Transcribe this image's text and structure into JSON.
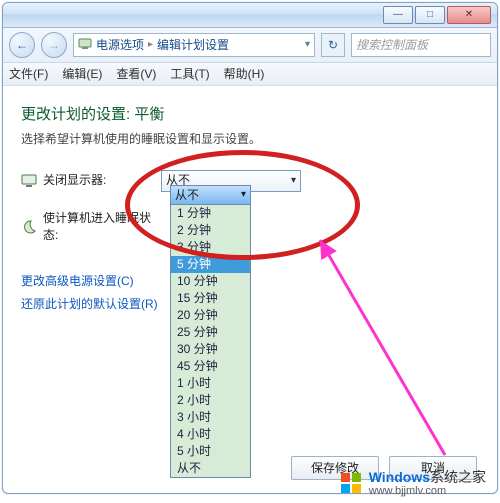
{
  "window": {
    "min": "—",
    "max": "□",
    "close": "✕"
  },
  "nav": {
    "back": "←",
    "forward": "→",
    "refresh": "↻",
    "crumb1": "电源选项",
    "crumb2": "编辑计划设置",
    "sep": "▸",
    "drop": "▾",
    "search_placeholder": "搜索控制面板"
  },
  "menu": {
    "file": "文件(F)",
    "edit": "编辑(E)",
    "view": "查看(V)",
    "tools": "工具(T)",
    "help": "帮助(H)"
  },
  "page": {
    "title": "更改计划的设置: 平衡",
    "subtitle": "选择希望计算机使用的睡眠设置和显示设置。"
  },
  "rows": {
    "display_off": "关闭显示器:",
    "sleep": "使计算机进入睡眠状态:",
    "display_value": "从不",
    "display_arrow": "▾"
  },
  "links": {
    "advanced": "更改高级电源设置(C)",
    "restore": "还原此计划的默认设置(R)"
  },
  "buttons": {
    "save": "保存修改",
    "cancel": "取消"
  },
  "dropdown": {
    "head": "从不",
    "head_arrow": "▾",
    "options": [
      "1 分钟",
      "2 分钟",
      "3 分钟",
      "5 分钟",
      "10 分钟",
      "15 分钟",
      "20 分钟",
      "25 分钟",
      "30 分钟",
      "45 分钟",
      "1 小时",
      "2 小时",
      "3 小时",
      "4 小时",
      "5 小时",
      "从不"
    ],
    "selected_index": 3
  },
  "watermark": {
    "brand_bold": "Windows",
    "brand_rest": "系统之家",
    "url": "www.bjjmlv.com"
  }
}
